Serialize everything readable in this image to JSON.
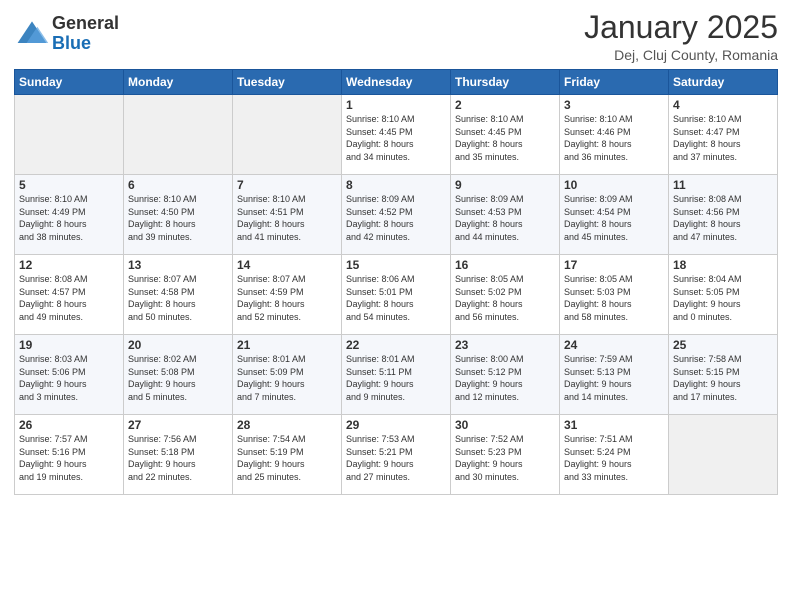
{
  "header": {
    "logo": {
      "general": "General",
      "blue": "Blue"
    },
    "title": "January 2025",
    "location": "Dej, Cluj County, Romania"
  },
  "weekdays": [
    "Sunday",
    "Monday",
    "Tuesday",
    "Wednesday",
    "Thursday",
    "Friday",
    "Saturday"
  ],
  "weeks": [
    [
      {
        "day": "",
        "info": ""
      },
      {
        "day": "",
        "info": ""
      },
      {
        "day": "",
        "info": ""
      },
      {
        "day": "1",
        "info": "Sunrise: 8:10 AM\nSunset: 4:45 PM\nDaylight: 8 hours\nand 34 minutes."
      },
      {
        "day": "2",
        "info": "Sunrise: 8:10 AM\nSunset: 4:45 PM\nDaylight: 8 hours\nand 35 minutes."
      },
      {
        "day": "3",
        "info": "Sunrise: 8:10 AM\nSunset: 4:46 PM\nDaylight: 8 hours\nand 36 minutes."
      },
      {
        "day": "4",
        "info": "Sunrise: 8:10 AM\nSunset: 4:47 PM\nDaylight: 8 hours\nand 37 minutes."
      }
    ],
    [
      {
        "day": "5",
        "info": "Sunrise: 8:10 AM\nSunset: 4:49 PM\nDaylight: 8 hours\nand 38 minutes."
      },
      {
        "day": "6",
        "info": "Sunrise: 8:10 AM\nSunset: 4:50 PM\nDaylight: 8 hours\nand 39 minutes."
      },
      {
        "day": "7",
        "info": "Sunrise: 8:10 AM\nSunset: 4:51 PM\nDaylight: 8 hours\nand 41 minutes."
      },
      {
        "day": "8",
        "info": "Sunrise: 8:09 AM\nSunset: 4:52 PM\nDaylight: 8 hours\nand 42 minutes."
      },
      {
        "day": "9",
        "info": "Sunrise: 8:09 AM\nSunset: 4:53 PM\nDaylight: 8 hours\nand 44 minutes."
      },
      {
        "day": "10",
        "info": "Sunrise: 8:09 AM\nSunset: 4:54 PM\nDaylight: 8 hours\nand 45 minutes."
      },
      {
        "day": "11",
        "info": "Sunrise: 8:08 AM\nSunset: 4:56 PM\nDaylight: 8 hours\nand 47 minutes."
      }
    ],
    [
      {
        "day": "12",
        "info": "Sunrise: 8:08 AM\nSunset: 4:57 PM\nDaylight: 8 hours\nand 49 minutes."
      },
      {
        "day": "13",
        "info": "Sunrise: 8:07 AM\nSunset: 4:58 PM\nDaylight: 8 hours\nand 50 minutes."
      },
      {
        "day": "14",
        "info": "Sunrise: 8:07 AM\nSunset: 4:59 PM\nDaylight: 8 hours\nand 52 minutes."
      },
      {
        "day": "15",
        "info": "Sunrise: 8:06 AM\nSunset: 5:01 PM\nDaylight: 8 hours\nand 54 minutes."
      },
      {
        "day": "16",
        "info": "Sunrise: 8:05 AM\nSunset: 5:02 PM\nDaylight: 8 hours\nand 56 minutes."
      },
      {
        "day": "17",
        "info": "Sunrise: 8:05 AM\nSunset: 5:03 PM\nDaylight: 8 hours\nand 58 minutes."
      },
      {
        "day": "18",
        "info": "Sunrise: 8:04 AM\nSunset: 5:05 PM\nDaylight: 9 hours\nand 0 minutes."
      }
    ],
    [
      {
        "day": "19",
        "info": "Sunrise: 8:03 AM\nSunset: 5:06 PM\nDaylight: 9 hours\nand 3 minutes."
      },
      {
        "day": "20",
        "info": "Sunrise: 8:02 AM\nSunset: 5:08 PM\nDaylight: 9 hours\nand 5 minutes."
      },
      {
        "day": "21",
        "info": "Sunrise: 8:01 AM\nSunset: 5:09 PM\nDaylight: 9 hours\nand 7 minutes."
      },
      {
        "day": "22",
        "info": "Sunrise: 8:01 AM\nSunset: 5:11 PM\nDaylight: 9 hours\nand 9 minutes."
      },
      {
        "day": "23",
        "info": "Sunrise: 8:00 AM\nSunset: 5:12 PM\nDaylight: 9 hours\nand 12 minutes."
      },
      {
        "day": "24",
        "info": "Sunrise: 7:59 AM\nSunset: 5:13 PM\nDaylight: 9 hours\nand 14 minutes."
      },
      {
        "day": "25",
        "info": "Sunrise: 7:58 AM\nSunset: 5:15 PM\nDaylight: 9 hours\nand 17 minutes."
      }
    ],
    [
      {
        "day": "26",
        "info": "Sunrise: 7:57 AM\nSunset: 5:16 PM\nDaylight: 9 hours\nand 19 minutes."
      },
      {
        "day": "27",
        "info": "Sunrise: 7:56 AM\nSunset: 5:18 PM\nDaylight: 9 hours\nand 22 minutes."
      },
      {
        "day": "28",
        "info": "Sunrise: 7:54 AM\nSunset: 5:19 PM\nDaylight: 9 hours\nand 25 minutes."
      },
      {
        "day": "29",
        "info": "Sunrise: 7:53 AM\nSunset: 5:21 PM\nDaylight: 9 hours\nand 27 minutes."
      },
      {
        "day": "30",
        "info": "Sunrise: 7:52 AM\nSunset: 5:23 PM\nDaylight: 9 hours\nand 30 minutes."
      },
      {
        "day": "31",
        "info": "Sunrise: 7:51 AM\nSunset: 5:24 PM\nDaylight: 9 hours\nand 33 minutes."
      },
      {
        "day": "",
        "info": ""
      }
    ]
  ]
}
